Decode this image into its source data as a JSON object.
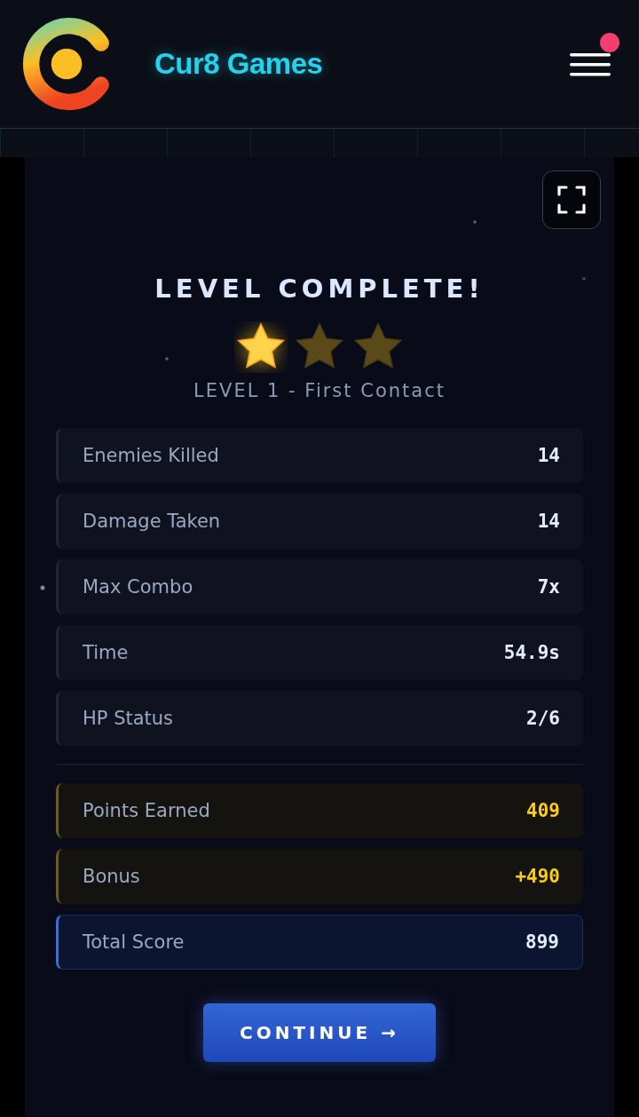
{
  "header": {
    "brand": "Cur8 Games",
    "menu_notification": true
  },
  "result": {
    "title": "LEVEL COMPLETE!",
    "stars": 1,
    "subtitle": "LEVEL 1 - First Contact"
  },
  "stats": [
    {
      "kind": "stat",
      "label": "Enemies Killed",
      "value": "14"
    },
    {
      "kind": "stat",
      "label": "Damage Taken",
      "value": "14"
    },
    {
      "kind": "stat",
      "label": "Max Combo",
      "value": "7x"
    },
    {
      "kind": "stat",
      "label": "Time",
      "value": "54.9s"
    },
    {
      "kind": "stat",
      "label": "HP Status",
      "value": "2/6"
    }
  ],
  "rewards": [
    {
      "kind": "reward",
      "label": "Points Earned",
      "value": "409"
    },
    {
      "kind": "reward",
      "label": "Bonus",
      "value": "+490"
    },
    {
      "kind": "total",
      "label": "Total Score",
      "value": "899"
    }
  ],
  "continue_button": "CONTINUE →"
}
